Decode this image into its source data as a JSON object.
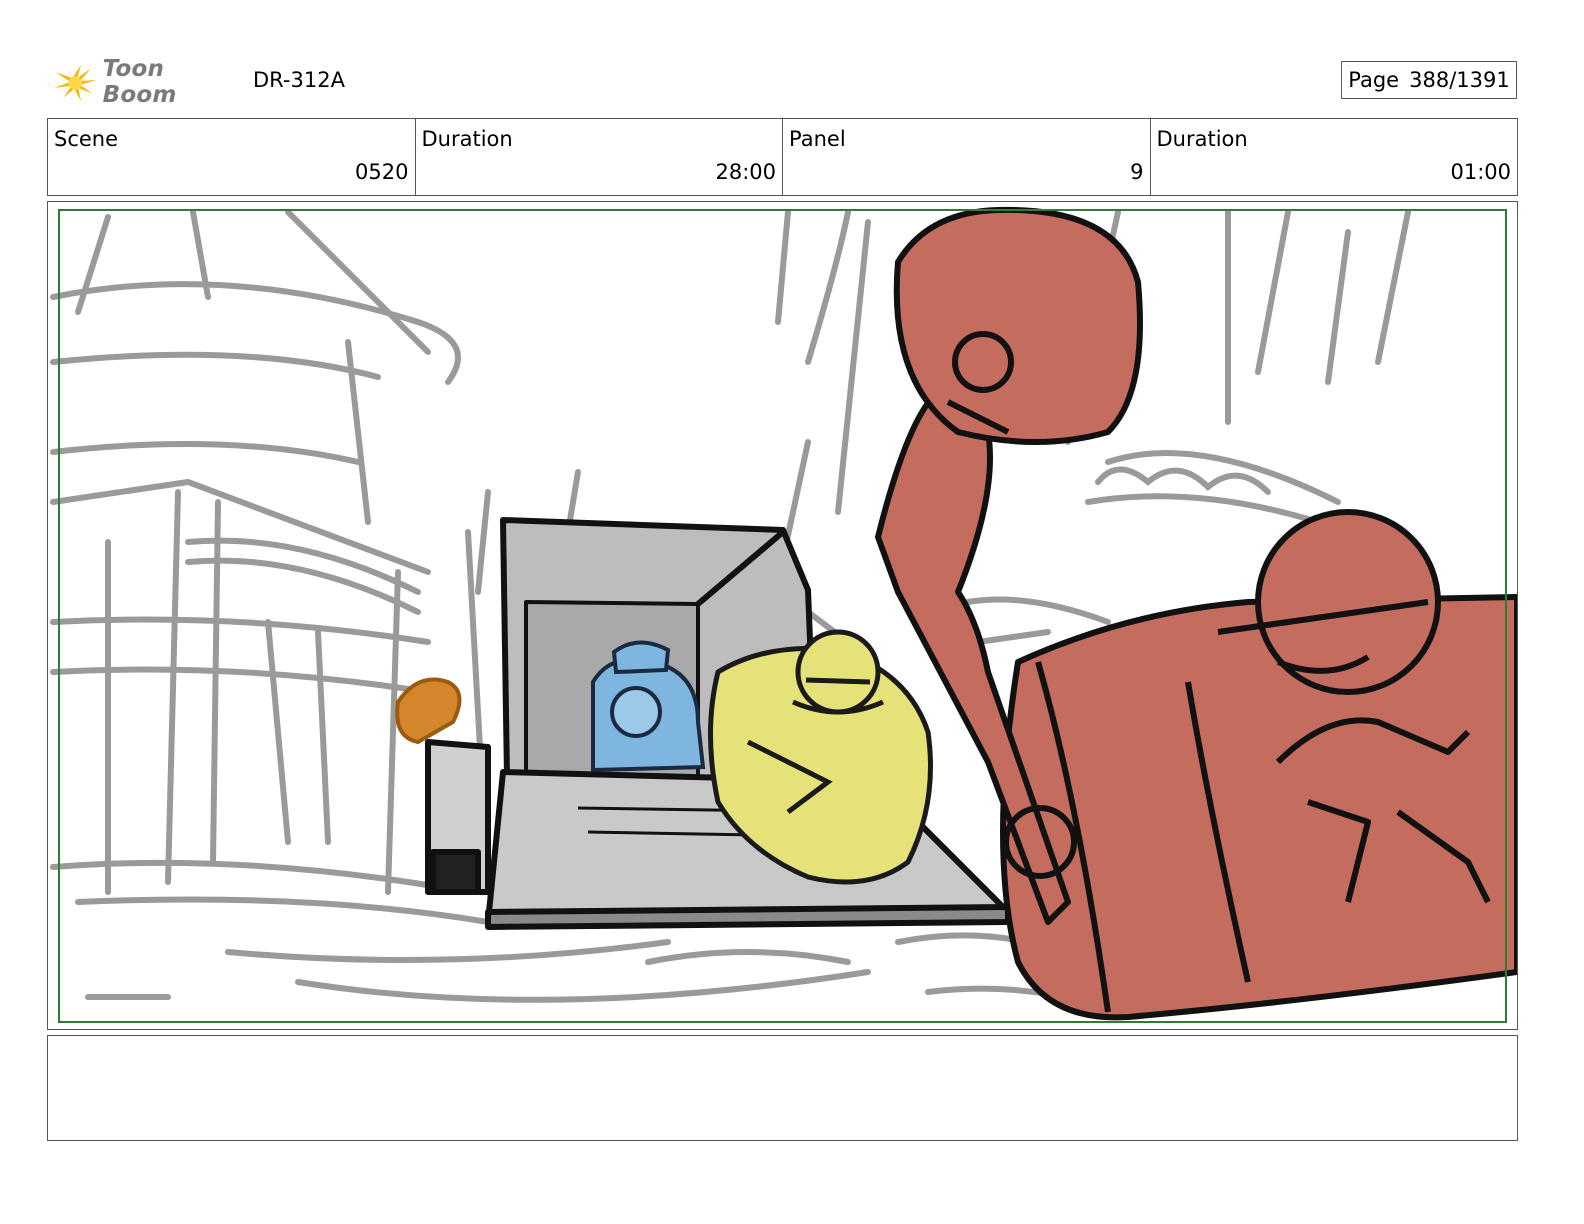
{
  "header": {
    "logo_text": "Toon Boom",
    "production_code": "DR-312A",
    "page_label": "Page",
    "page_number": "388/1391"
  },
  "info": {
    "scene_label": "Scene",
    "scene_value": "0520",
    "scene_duration_label": "Duration",
    "scene_duration_value": "28:00",
    "panel_label": "Panel",
    "panel_value": "9",
    "panel_duration_label": "Duration",
    "panel_duration_value": "01:00"
  },
  "colors": {
    "sketch_gray": "#999999",
    "ramp_gray": "#c4c4c4",
    "character_blue": "#7fb6e0",
    "character_yellow": "#e6e27a",
    "machine_red": "#c46d5e",
    "character_orange": "#d4862a",
    "safe_frame_green": "#2e7d32"
  },
  "notes": {
    "text": ""
  }
}
